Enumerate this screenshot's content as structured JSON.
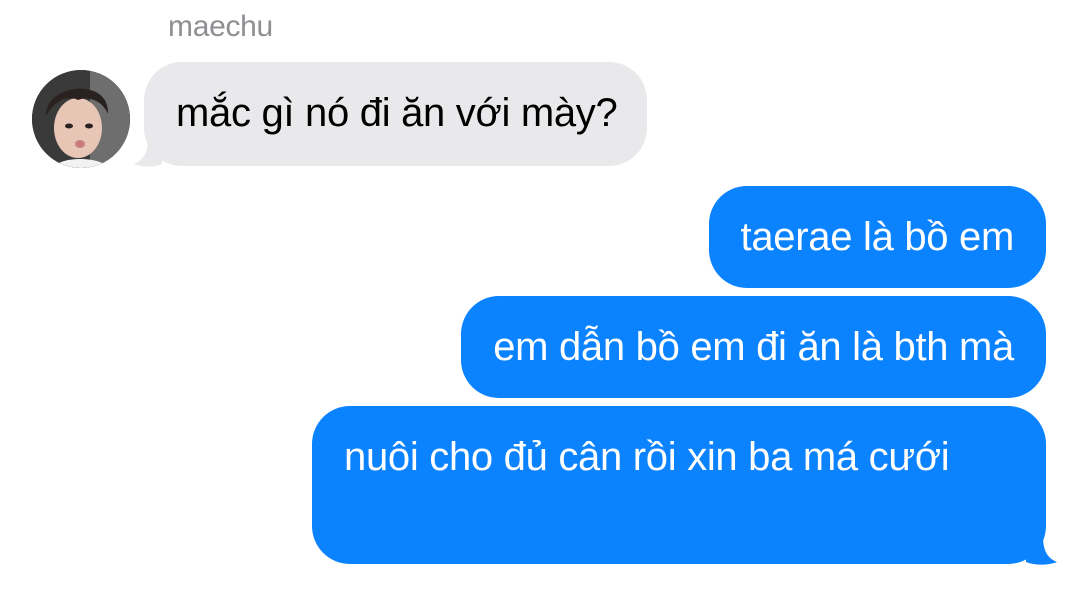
{
  "conversation": {
    "sender": {
      "name": "maechu",
      "avatar_icon": "user-avatar-photo"
    },
    "messages": [
      {
        "direction": "incoming",
        "text": "mắc gì nó đi ăn với mày?"
      },
      {
        "direction": "outgoing",
        "text": "taerae là bồ em"
      },
      {
        "direction": "outgoing",
        "text": "em dẫn bồ em đi ăn là bth mà"
      },
      {
        "direction": "outgoing",
        "text": "nuôi cho đủ cân rồi xin ba má cưới"
      }
    ]
  },
  "colors": {
    "incoming_bubble": "#e9e9eb",
    "outgoing_bubble": "#0b82fe",
    "sender_name": "#8e8e93"
  }
}
